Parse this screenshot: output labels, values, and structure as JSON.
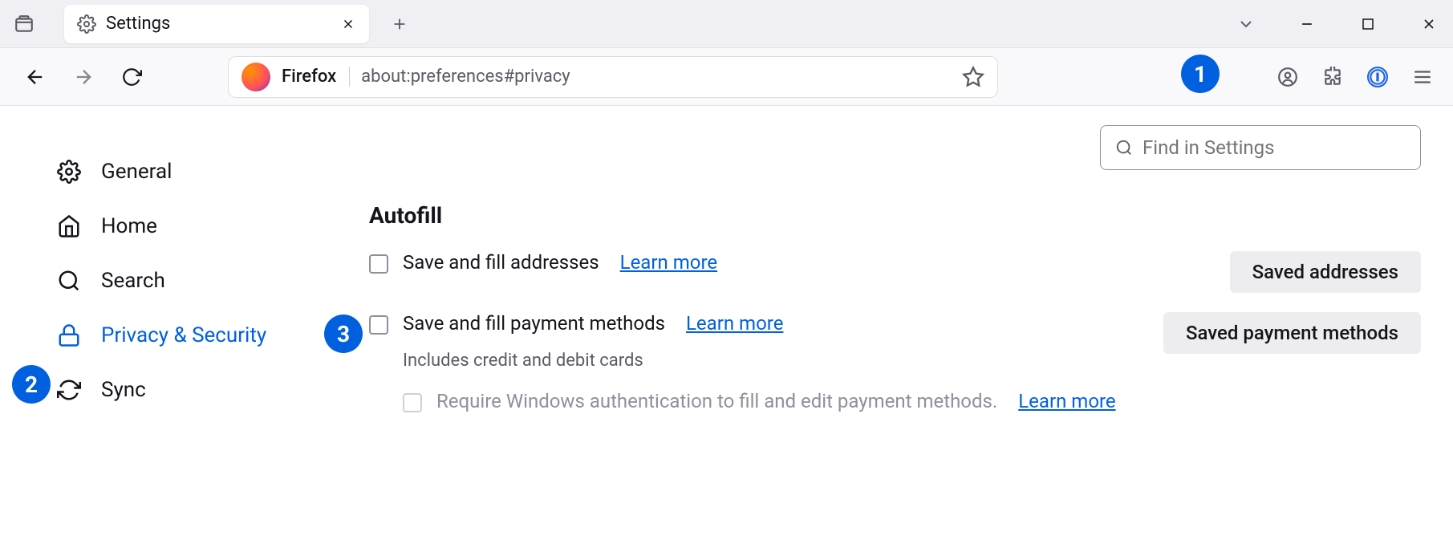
{
  "tab": {
    "title": "Settings"
  },
  "urlbar": {
    "prefix": "Firefox",
    "url": "about:preferences#privacy"
  },
  "search": {
    "placeholder": "Find in Settings"
  },
  "sidebar": {
    "items": [
      {
        "label": "General"
      },
      {
        "label": "Home"
      },
      {
        "label": "Search"
      },
      {
        "label": "Privacy & Security"
      },
      {
        "label": "Sync"
      }
    ]
  },
  "main": {
    "section_title": "Autofill",
    "addresses": {
      "label": "Save and fill addresses",
      "learn": "Learn more",
      "button": "Saved addresses"
    },
    "payments": {
      "label": "Save and fill payment methods",
      "learn": "Learn more",
      "sub": "Includes credit and debit cards",
      "button": "Saved payment methods"
    },
    "require_auth": {
      "label": "Require Windows authentication to fill and edit payment methods.",
      "learn": "Learn more"
    }
  },
  "callouts": {
    "c1": "1",
    "c2": "2",
    "c3": "3"
  }
}
